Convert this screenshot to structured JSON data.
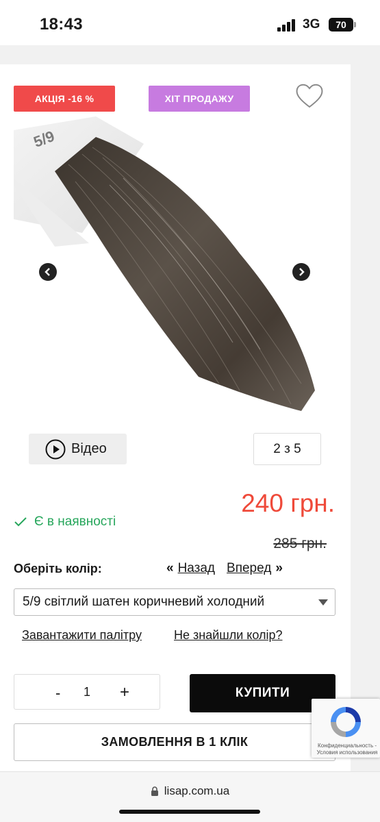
{
  "status_bar": {
    "time": "18:43",
    "network": "3G",
    "battery": "70"
  },
  "product": {
    "badges": {
      "sale": "АКЦІЯ -16 %",
      "hit": "ХІТ ПРОДАЖУ"
    },
    "image_label": "5/9",
    "video_label": "Відео",
    "image_counter": "2 з 5",
    "price": "240 грн.",
    "old_price": "285 грн.",
    "stock": "Є в наявності"
  },
  "color_picker": {
    "label": "Оберіть колір:",
    "prev_symbol": "«",
    "prev": "Назад",
    "next": "Вперед",
    "next_symbol": "»",
    "selected": "5/9 світлий шатен коричневий холодний"
  },
  "links": {
    "download_palette": "Завантажити палітру",
    "not_found": "Не знайшли колір?"
  },
  "cart": {
    "minus": "-",
    "quantity": "1",
    "plus": "+",
    "buy": "КУПИТИ",
    "one_click": "ЗАМОВЛЕННЯ В 1 КЛІК"
  },
  "recaptcha": {
    "text": "Конфиденциальность - Условия использования"
  },
  "browser": {
    "url": "lisap.com.ua"
  },
  "colors": {
    "sale_badge": "#f04a4a",
    "hit_badge": "#c77be0",
    "price": "#ef4a3a",
    "stock": "#26a65b",
    "buy_button": "#0b0b0b"
  }
}
